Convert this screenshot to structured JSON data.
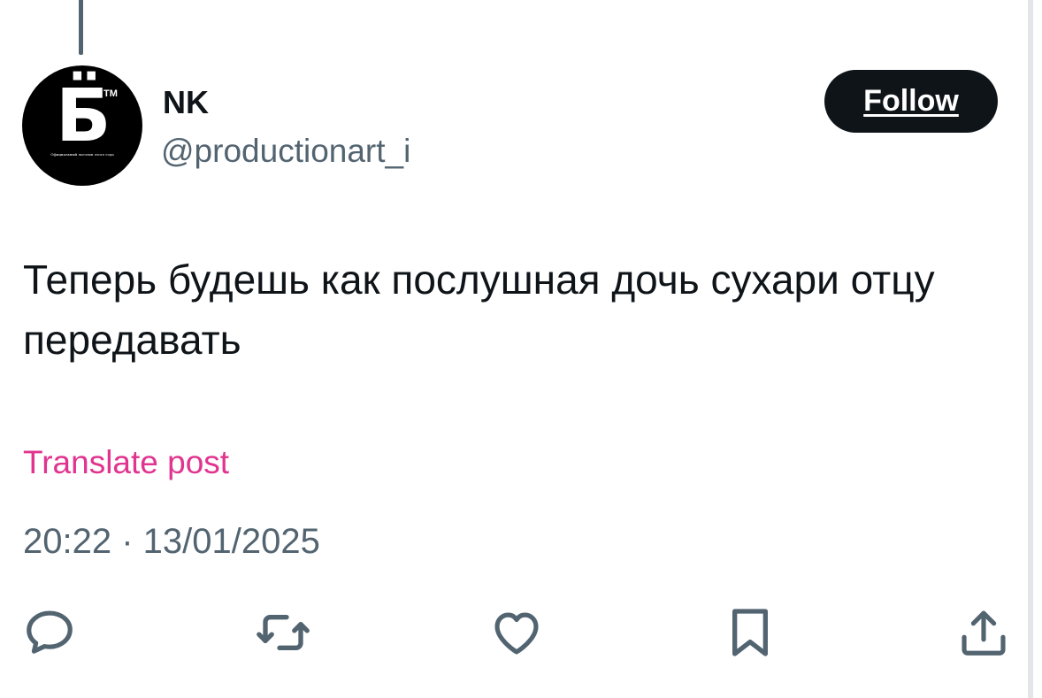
{
  "author": {
    "display_name": "NK",
    "handle": "@productionart_i",
    "avatar": {
      "letter": "Б̈",
      "tm": "TM",
      "caption": "Официальный логотип этого года"
    }
  },
  "follow_label": "Follow",
  "post": {
    "text": "Теперь будешь как послушная дочь сухари отцу передавать",
    "translate_label": "Translate post",
    "timestamp": "20:22 · 13/01/2025"
  },
  "actions": [
    {
      "icon": "reply-icon"
    },
    {
      "icon": "repost-icon"
    },
    {
      "icon": "like-icon"
    },
    {
      "icon": "bookmark-icon"
    },
    {
      "icon": "share-icon"
    }
  ],
  "colors": {
    "text": "#0f1419",
    "secondary": "#536471",
    "link": "#e0348f",
    "button_bg": "#0f1419"
  }
}
